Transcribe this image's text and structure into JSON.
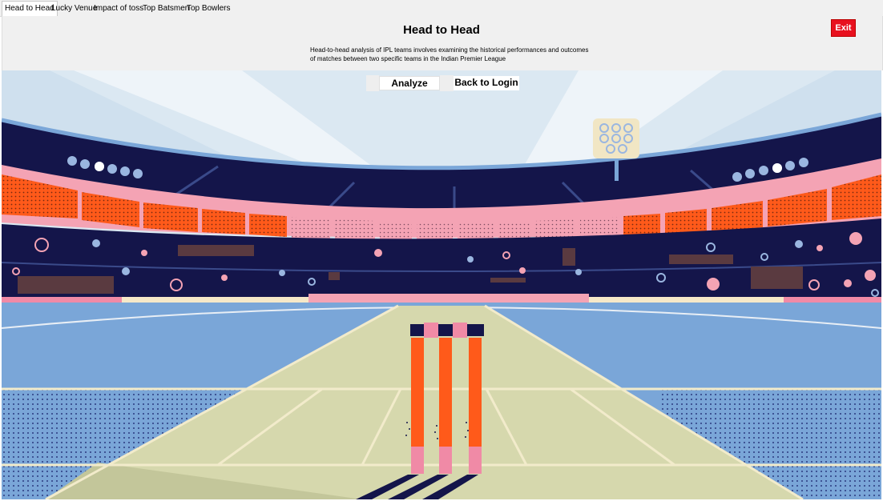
{
  "tabs": [
    {
      "label": "Head to Head",
      "active": true
    },
    {
      "label": "Lucky Venue",
      "active": false
    },
    {
      "label": "Impact of toss",
      "active": false
    },
    {
      "label": "Top Batsmen",
      "active": false
    },
    {
      "label": "Top Bowlers",
      "active": false
    }
  ],
  "header": {
    "title": "Head to Head",
    "description": "Head-to-head analysis of IPL teams involves examining the historical performances and outcomes of matches between two specific teams in the Indian Premier League",
    "exit_label": "Exit"
  },
  "actions": {
    "analyze_label": "Analyze",
    "back_label": "Back to Login"
  },
  "colors": {
    "exit_bg": "#e8111f",
    "stands_orange": "#ff5a1a",
    "stands_pink": "#f4a3b4",
    "pitch": "#d6d8ad",
    "field": "#7aa6d8",
    "sky": "#dbe8f2",
    "navy": "#14154a"
  },
  "background": {
    "image": "cricket-stadium-illustration"
  }
}
